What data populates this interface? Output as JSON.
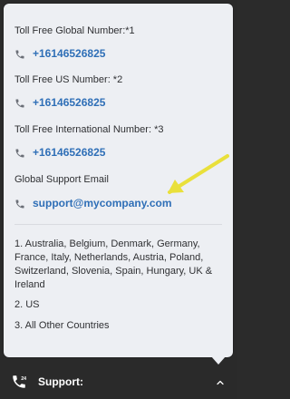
{
  "popup": {
    "global_number_label": "Toll Free Global Number:*1",
    "global_number": "+16146526825",
    "us_number_label": "Toll Free US Number: *2",
    "us_number": "+16146526825",
    "intl_number_label": "Toll Free International Number: *3",
    "intl_number": "+16146526825",
    "support_email_label": "Global Support Email",
    "support_email": "support@mycompany.com",
    "notes": [
      "1. Australia, Belgium, Denmark, Germany, France, Italy, Netherlands, Austria, Poland, Switzerland, Slovenia, Spain, Hungary, UK & Ireland",
      "2. US",
      "3. All Other Countries"
    ]
  },
  "footer": {
    "title": "Support:",
    "icon": "phone-24-icon",
    "chevron_icon": "chevron-up-icon"
  },
  "colors": {
    "popup_bg": "#edeff3",
    "link": "#2f6fb7",
    "footer_bg": "#2a2a2a",
    "annotation_arrow": "#e9e03b"
  }
}
